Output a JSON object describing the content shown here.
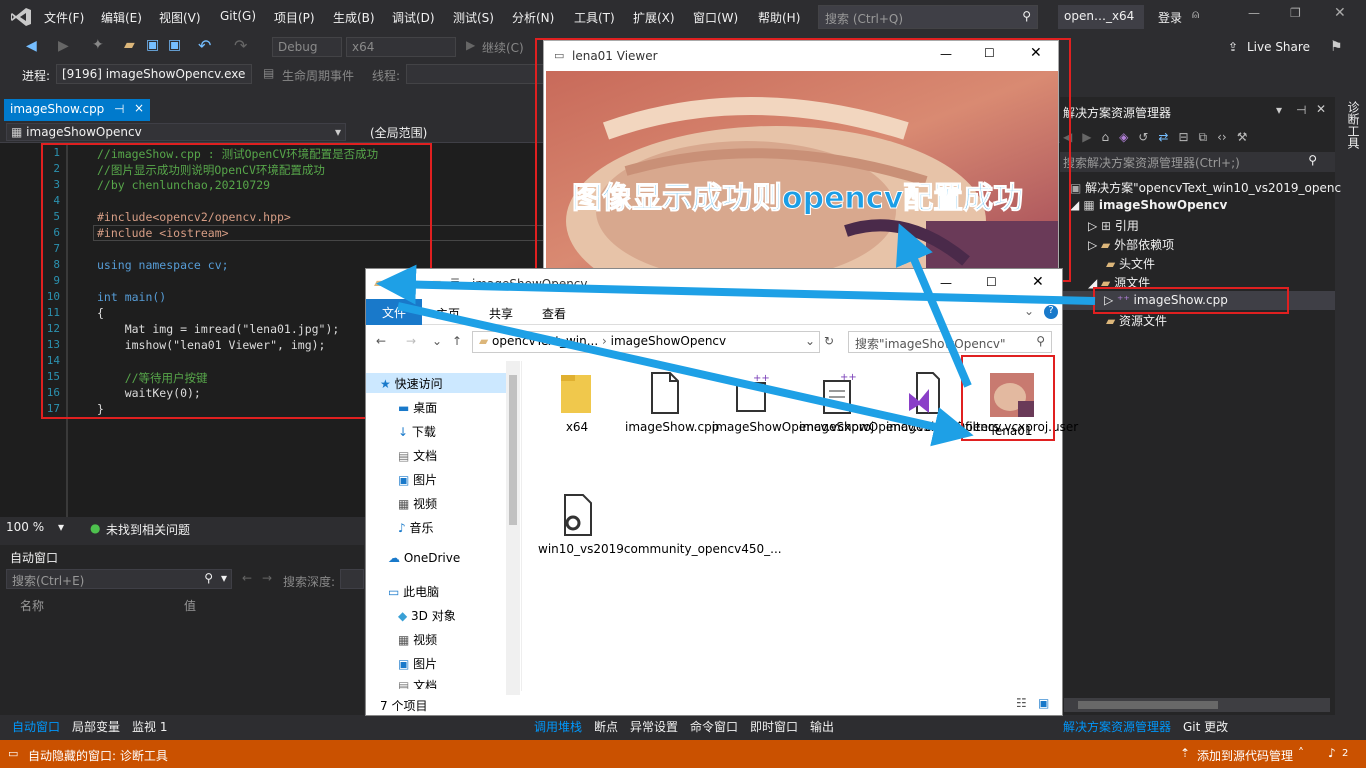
{
  "menu": [
    "文件(F)",
    "编辑(E)",
    "视图(V)",
    "Git(G)",
    "项目(P)",
    "生成(B)",
    "调试(D)",
    "测试(S)",
    "分析(N)",
    "工具(T)",
    "扩展(X)",
    "窗口(W)",
    "帮助(H)"
  ],
  "search": {
    "placeholder": "搜索 (Ctrl+Q)"
  },
  "window_title": "open…_x64",
  "login": "登录",
  "live_share": "Live Share",
  "toolbar": {
    "config": "Debug",
    "platform": "x64",
    "continue": "继续(C)"
  },
  "process": {
    "label": "进程:",
    "value": "[9196] imageShowOpencv.exe",
    "lifecycle": "生命周期事件",
    "thread": "线程:"
  },
  "tab": {
    "name": "imageShow.cpp",
    "pin": "⊣",
    "close": "×"
  },
  "nav": {
    "project": "imageShowOpencv",
    "scope": "(全局范围)"
  },
  "code_lines": [
    {
      "n": "1",
      "t": "//imageShow.cpp : 测试OpenCV环境配置是否成功"
    },
    {
      "n": "2",
      "t": "//图片显示成功则说明OpenCV环境配置成功"
    },
    {
      "n": "3",
      "t": "//by chenlunchao,20210729"
    },
    {
      "n": "4",
      "t": ""
    },
    {
      "n": "5",
      "t": "#include<opencv2/opencv.hpp>"
    },
    {
      "n": "6",
      "t": "#include <iostream>"
    },
    {
      "n": "7",
      "t": ""
    },
    {
      "n": "8",
      "t": "using namespace cv;"
    },
    {
      "n": "9",
      "t": ""
    },
    {
      "n": "10",
      "t": "int main()"
    },
    {
      "n": "11",
      "t": "{"
    },
    {
      "n": "12",
      "t": "    Mat img = imread(\"lena01.jpg\");"
    },
    {
      "n": "13",
      "t": "    imshow(\"lena01 Viewer\", img);"
    },
    {
      "n": "14",
      "t": ""
    },
    {
      "n": "15",
      "t": "    //等待用户按键"
    },
    {
      "n": "16",
      "t": "    waitKey(0);"
    },
    {
      "n": "17",
      "t": "}"
    }
  ],
  "editor_status": {
    "zoom": "100 %",
    "issues": "未找到相关问题"
  },
  "autos": {
    "title": "自动窗口",
    "search": "搜索(Ctrl+E)",
    "depth": "搜索深度:",
    "col_name": "名称",
    "col_value": "值"
  },
  "bottom_tabs": {
    "left": [
      "自动窗口",
      "局部变量",
      "监视 1"
    ],
    "middle": [
      "调用堆栈",
      "断点",
      "异常设置",
      "命令窗口",
      "即时窗口",
      "输出"
    ],
    "right": [
      "解决方案资源管理器",
      "Git 更改"
    ]
  },
  "statusbar": {
    "left": "自动隐藏的窗口: 诊断工具",
    "right": "添加到源代码管理",
    "notif": "2"
  },
  "solution": {
    "title": "解决方案资源管理器",
    "search": "搜索解决方案资源管理器(Ctrl+;)",
    "items": [
      {
        "label": "解决方案\"opencvText_win10_vs2019_openc"
      },
      {
        "label": "imageShowOpencv"
      },
      {
        "label": "引用"
      },
      {
        "label": "外部依赖项"
      },
      {
        "label": "头文件"
      },
      {
        "label": "源文件"
      },
      {
        "label": "imageShow.cpp"
      },
      {
        "label": "资源文件"
      }
    ],
    "side_tab": "诊断工具"
  },
  "viewer": {
    "title": "lena01 Viewer",
    "overlay": "图像显示成功则opencv配置成功"
  },
  "explorer": {
    "title": "imageShowOpencv",
    "ribbon": [
      "文件",
      "主页",
      "共享",
      "查看"
    ],
    "breadcrumb": [
      "opencvText_win...",
      "imageShowOpencv"
    ],
    "search": "搜索\"imageShowOpencv\"",
    "nav": [
      "快速访问",
      "桌面",
      "下载",
      "文档",
      "图片",
      "视频",
      "音乐",
      "OneDrive",
      "此电脑",
      "3D 对象",
      "视频",
      "图片",
      "文档"
    ],
    "files": [
      {
        "name": "x64"
      },
      {
        "name": "imageShow.cpp"
      },
      {
        "name": "imageShowOpencv.vcxproj"
      },
      {
        "name": "imageShowOpencv.vcxproj.filters"
      },
      {
        "name": "imageShowOpencv.vcxproj.user"
      },
      {
        "name": "lena01"
      },
      {
        "name": "win10_vs2019community_opencv450_..."
      }
    ],
    "count": "7 个项目"
  }
}
